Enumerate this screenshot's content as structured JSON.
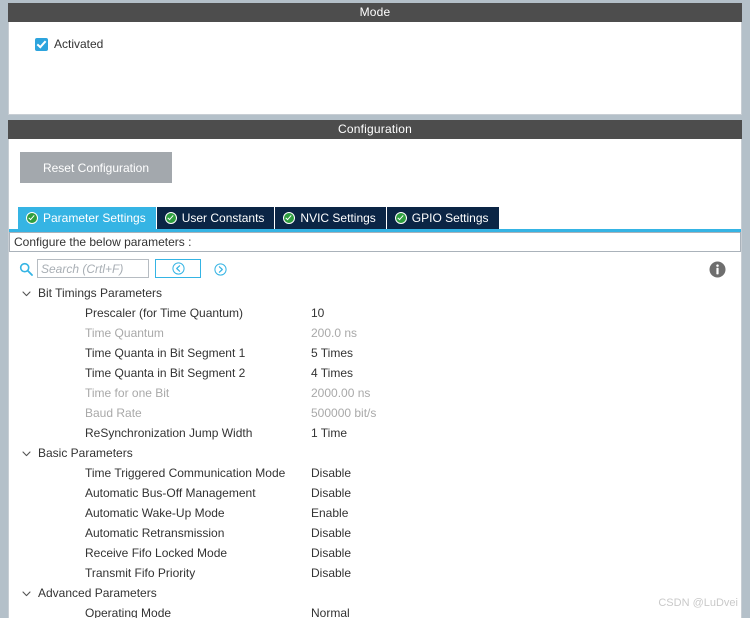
{
  "mode": {
    "header": "Mode",
    "checkbox": {
      "label": "Activated",
      "checked": true,
      "color": "#2da4dd"
    }
  },
  "configuration": {
    "header": "Configuration",
    "reset_button": "Reset Configuration",
    "tabs": [
      {
        "label": "Parameter Settings",
        "icon": "green-check-icon",
        "active": true
      },
      {
        "label": "User Constants",
        "icon": "green-check-icon",
        "active": false
      },
      {
        "label": "NVIC Settings",
        "icon": "green-check-icon",
        "active": false
      },
      {
        "label": "GPIO Settings",
        "icon": "green-check-icon",
        "active": false
      }
    ],
    "configure_hint": "Configure the below parameters :",
    "search": {
      "placeholder": "Search (Crtl+F)",
      "value": "",
      "icon": "search-icon",
      "prev_icon": "chevron-left-circle-icon",
      "next_icon": "chevron-right-circle-icon"
    },
    "info_icon": "info-icon",
    "accent_color": "#35b4e4",
    "tab_inactive_color": "#0b2545",
    "groups": [
      {
        "label": "Bit Timings Parameters",
        "expanded": true,
        "rows": [
          {
            "name": "Prescaler (for Time Quantum)",
            "value": "10",
            "dim": false
          },
          {
            "name": "Time Quantum",
            "value": "200.0 ns",
            "dim": true
          },
          {
            "name": "Time Quanta in Bit Segment 1",
            "value": "5 Times",
            "dim": false
          },
          {
            "name": "Time Quanta in Bit Segment 2",
            "value": "4 Times",
            "dim": false
          },
          {
            "name": "Time for one Bit",
            "value": "2000.00 ns",
            "dim": true
          },
          {
            "name": "Baud Rate",
            "value": "500000 bit/s",
            "dim": true
          },
          {
            "name": "ReSynchronization Jump Width",
            "value": "1 Time",
            "dim": false
          }
        ]
      },
      {
        "label": "Basic Parameters",
        "expanded": true,
        "rows": [
          {
            "name": "Time Triggered Communication Mode",
            "value": "Disable",
            "dim": false
          },
          {
            "name": "Automatic Bus-Off Management",
            "value": "Disable",
            "dim": false
          },
          {
            "name": "Automatic Wake-Up Mode",
            "value": "Enable",
            "dim": false
          },
          {
            "name": "Automatic Retransmission",
            "value": "Disable",
            "dim": false
          },
          {
            "name": "Receive Fifo Locked Mode",
            "value": "Disable",
            "dim": false
          },
          {
            "name": "Transmit Fifo Priority",
            "value": "Disable",
            "dim": false
          }
        ]
      },
      {
        "label": "Advanced Parameters",
        "expanded": true,
        "rows": [
          {
            "name": "Operating Mode",
            "value": "Normal",
            "dim": false
          }
        ]
      }
    ]
  },
  "watermark": "CSDN @LuDvei"
}
